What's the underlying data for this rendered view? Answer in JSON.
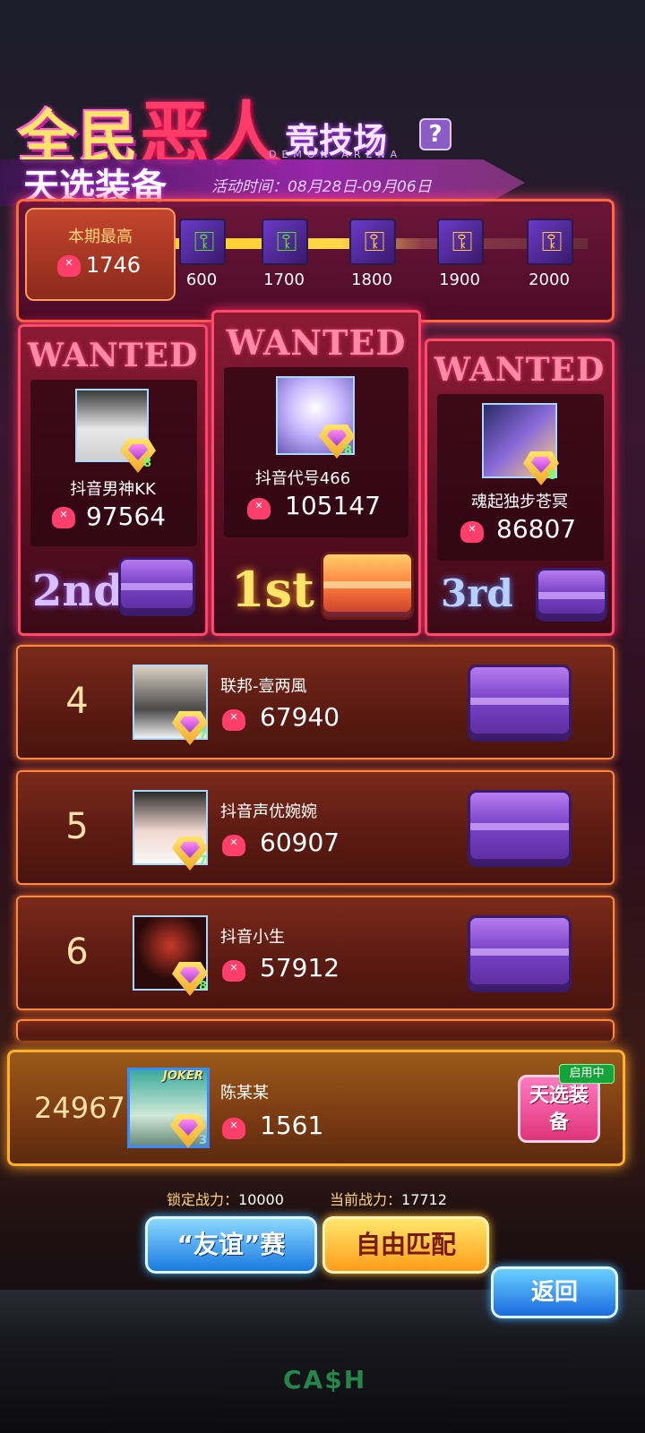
{
  "header": {
    "title_part1": "全民",
    "title_evil": "恶人",
    "title_part2": "竞技场",
    "help_label": "?",
    "subtitle_en": "DEMON ARENA",
    "banner": "天选装备",
    "event_time": "活动时间：08月28日-09月06日"
  },
  "record": {
    "label": "本期最高",
    "value": "1746",
    "milestones": [
      {
        "threshold": "600",
        "icon": "green-key-icon"
      },
      {
        "threshold": "1700",
        "icon": "green-key-icon"
      },
      {
        "threshold": "1800",
        "icon": "gold-key-icon"
      },
      {
        "threshold": "1900",
        "icon": "gold-key-icon"
      },
      {
        "threshold": "2000",
        "icon": "gold-key-icon"
      }
    ]
  },
  "podium": [
    {
      "wanted": "WANTED",
      "name": "抖音代号466",
      "score": "105147",
      "level": "8",
      "rank": "1st"
    },
    {
      "wanted": "WANTED",
      "name": "抖音男神KK",
      "score": "97564",
      "level": "8",
      "rank": "2nd"
    },
    {
      "wanted": "WANTED",
      "name": "魂起独步苍冥",
      "score": "86807",
      "level": "8",
      "rank": "3rd"
    }
  ],
  "ranking": [
    {
      "rank": "4",
      "name": "联邦-壹两風",
      "score": "67940",
      "level": "7"
    },
    {
      "rank": "5",
      "name": "抖音声优婉婉",
      "score": "60907",
      "level": "7"
    },
    {
      "rank": "6",
      "name": "抖音小生",
      "score": "57912",
      "level": "8"
    }
  ],
  "self": {
    "rank": "24967",
    "name": "陈某某",
    "score": "1561",
    "level": "3",
    "avatar_tag": "JOKER",
    "equip_btn": "天选装备",
    "active_tag": "启用中"
  },
  "power": {
    "locked_label": "锁定战力：",
    "locked_value": "10000",
    "current_label": "当前战力：",
    "current_value": "17712"
  },
  "buttons": {
    "friendly": "“友谊”赛",
    "free_match": "自由匹配",
    "back": "返回"
  },
  "decor": {
    "cash": "CA$H"
  },
  "colors": {
    "accent": "#ff4a6c",
    "gold": "#ffd27a",
    "blue": "#1a7ae0"
  }
}
